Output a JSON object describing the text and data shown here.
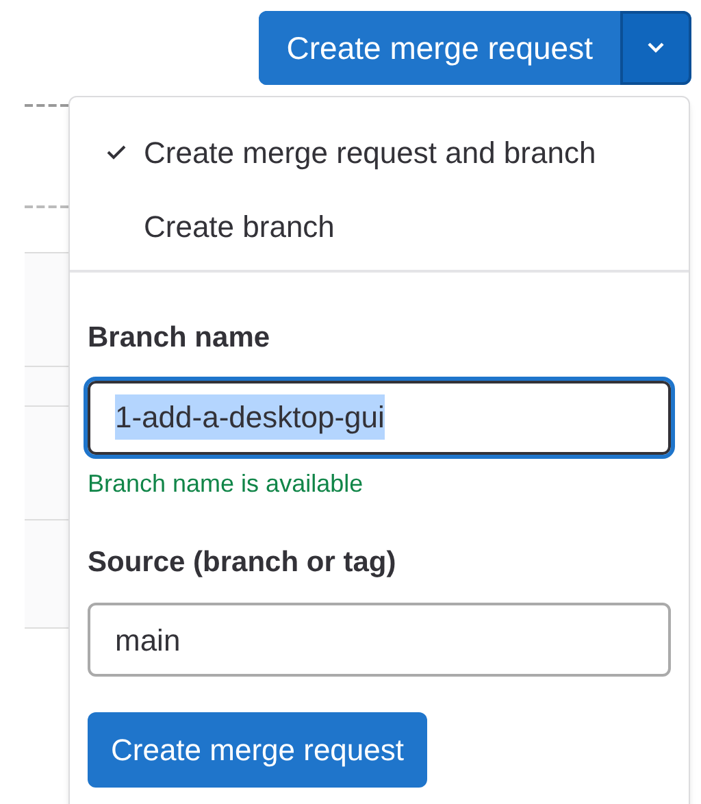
{
  "split_button": {
    "label": "Create merge request",
    "expanded": true
  },
  "menu": {
    "options": [
      {
        "label": "Create merge request and branch",
        "selected": true
      },
      {
        "label": "Create branch",
        "selected": false
      }
    ],
    "branch_name": {
      "label": "Branch name",
      "value": "1-add-a-desktop-gui",
      "focused": true,
      "message": "Branch name is available"
    },
    "source": {
      "label": "Source (branch or tag)",
      "value": "main",
      "focused": false
    },
    "submit": "Create merge request"
  }
}
